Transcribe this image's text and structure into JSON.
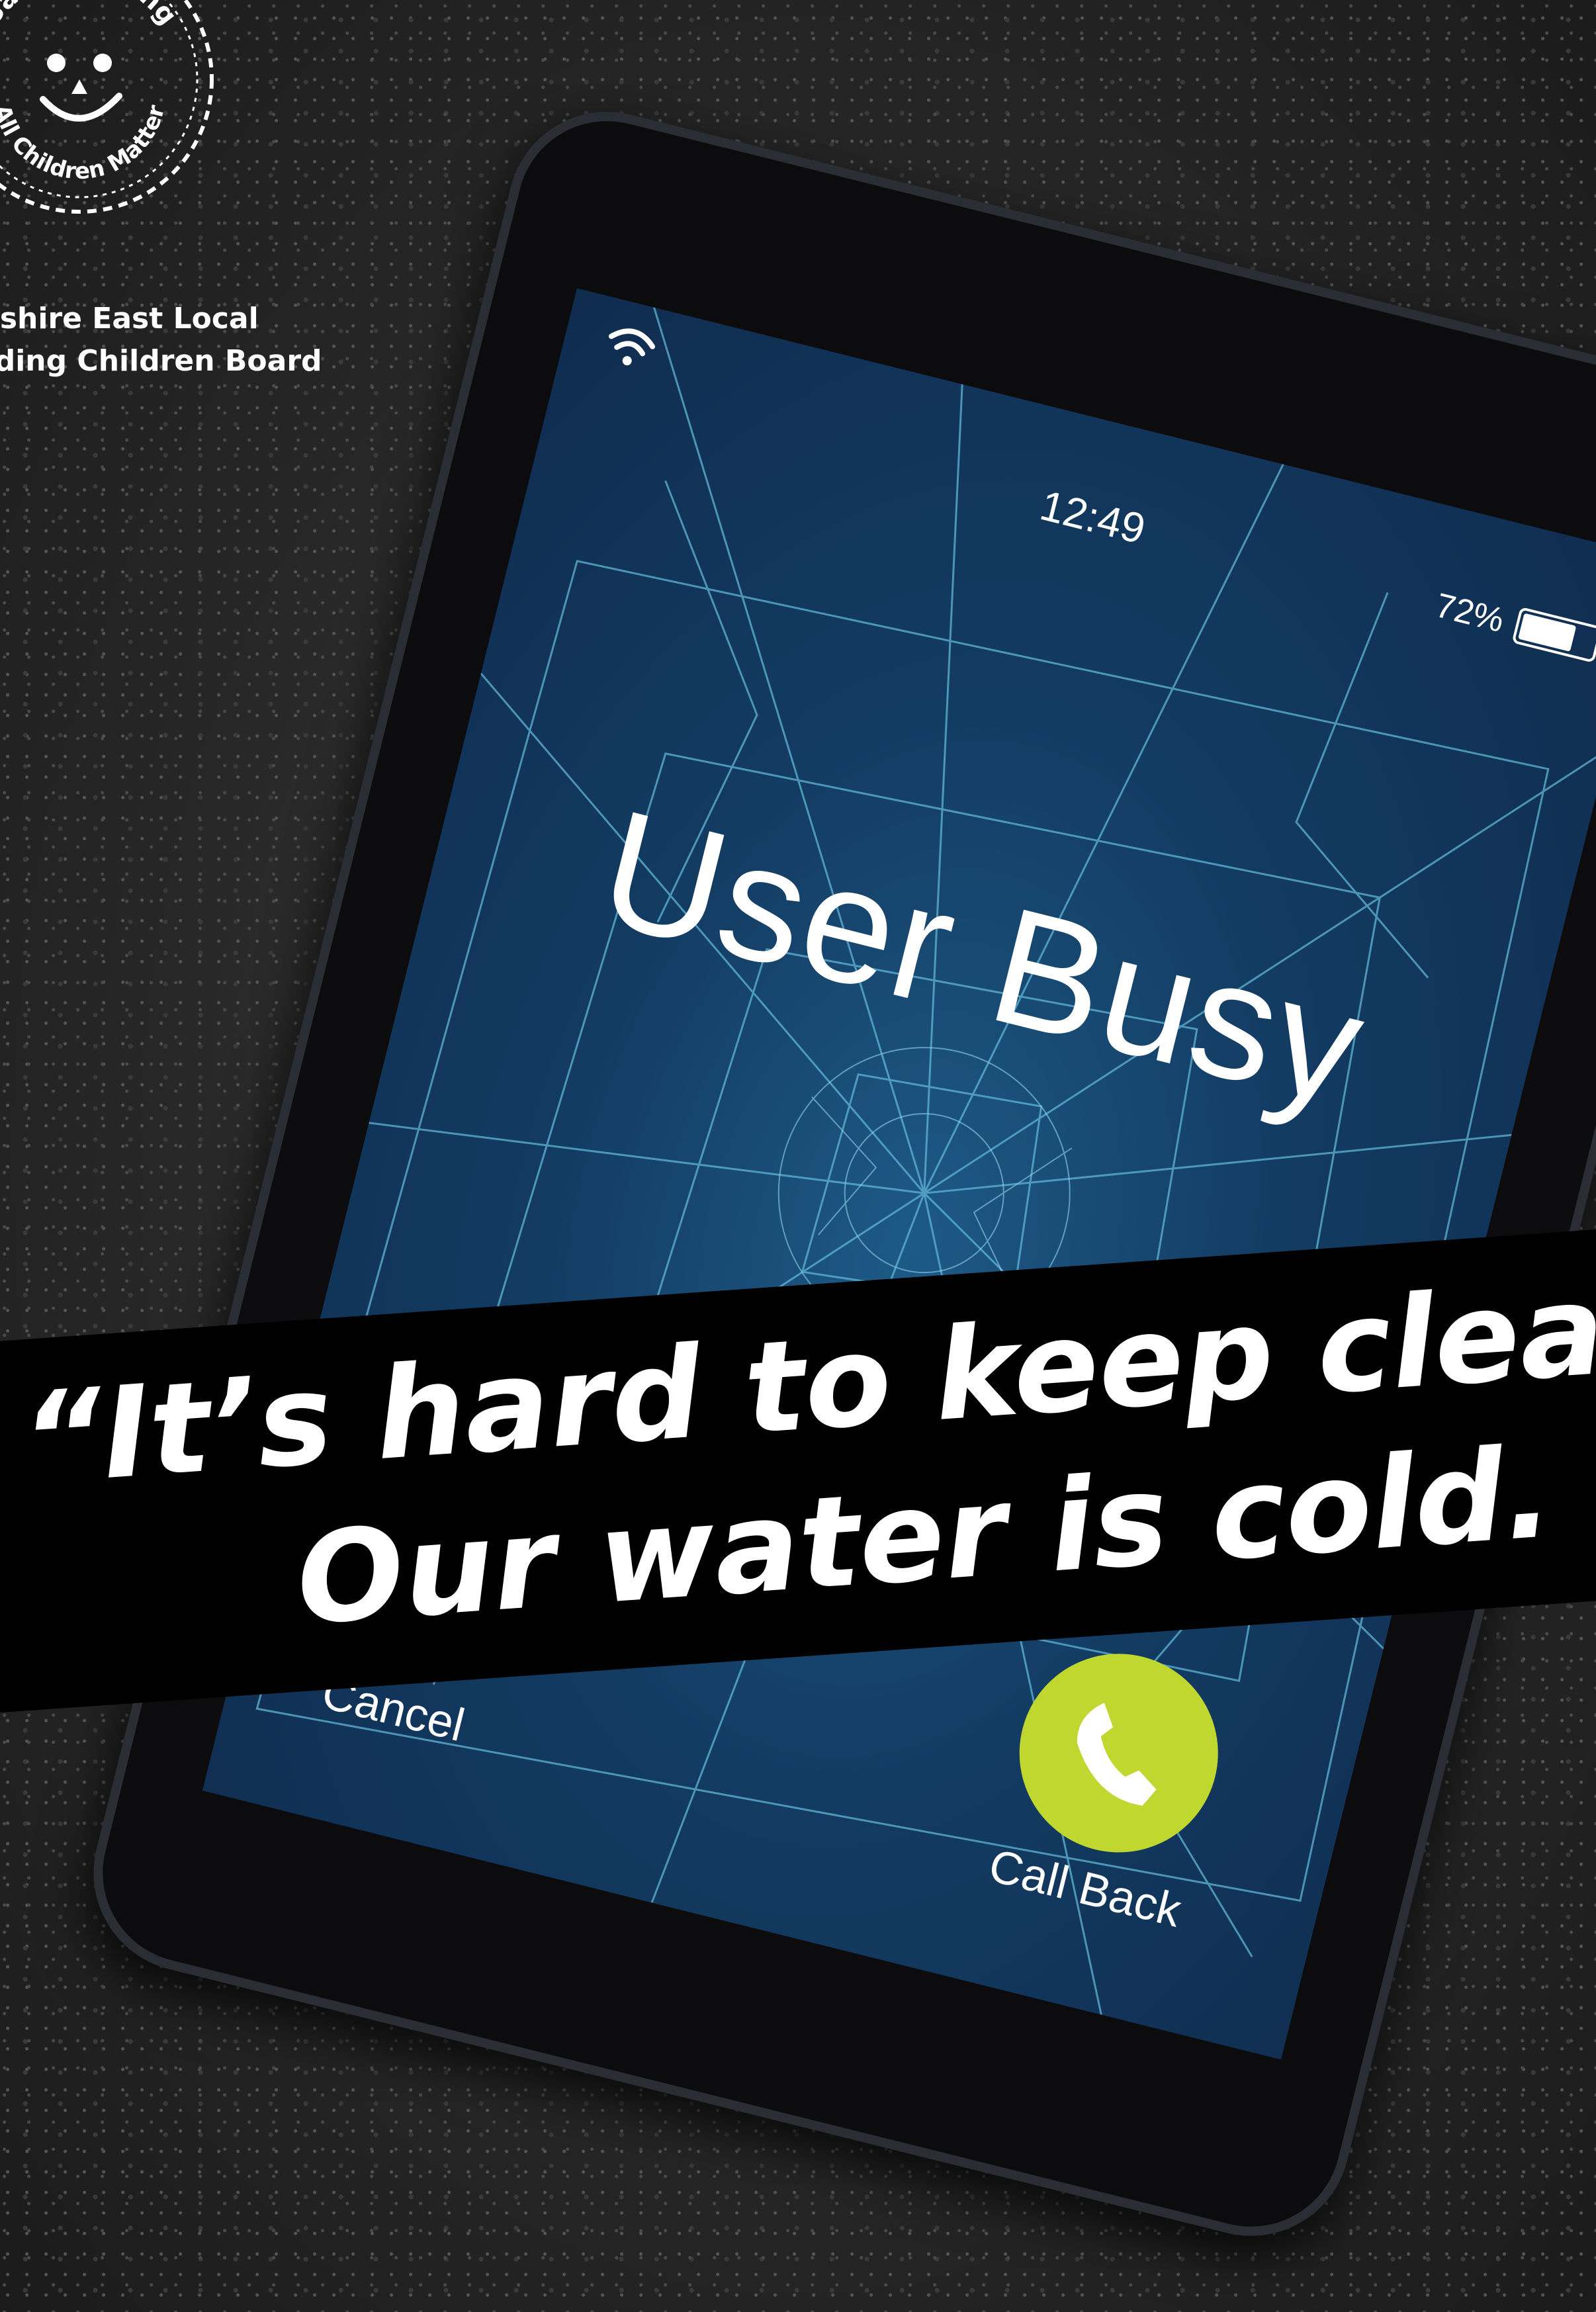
{
  "organization": {
    "logo_ring_text_top": "Safeguarding",
    "logo_ring_text_bottom": "All Children Matter",
    "board_name": "eshire East Local\nrding Children Board"
  },
  "phone": {
    "clock": "12:49",
    "battery_percent": "72%",
    "battery_level": 0.72,
    "call_status": "User Busy",
    "cancel_label": "Cancel",
    "callback_label": "Call Back",
    "wifi_icon": "wifi-icon",
    "handset_icon": "phone-handset-icon",
    "callback_color": "#bfd72f",
    "screen_color": "#133c63"
  },
  "quote": {
    "line1": "“It’s hard to keep clean.",
    "line2": "Our water is cold. ”"
  }
}
